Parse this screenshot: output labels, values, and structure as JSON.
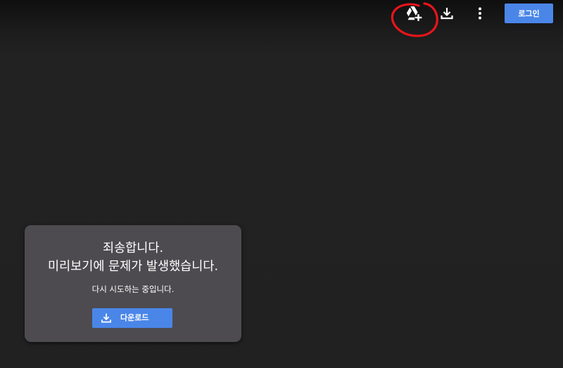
{
  "toolbar": {
    "add_to_drive_icon": "drive-add-icon",
    "download_icon": "download-icon",
    "more_icon": "more-vert-icon",
    "login_label": "로그인",
    "login_color": "#4a86e8"
  },
  "annotation": {
    "color": "#e8141b"
  },
  "error_card": {
    "title_line1": "죄송합니다.",
    "title_line2": "미리보기에 문제가 발생했습니다.",
    "subtitle": "다시 시도하는 중입니다.",
    "download_label": "다운로드",
    "download_icon": "download-icon",
    "background": "#4d4b4f"
  }
}
